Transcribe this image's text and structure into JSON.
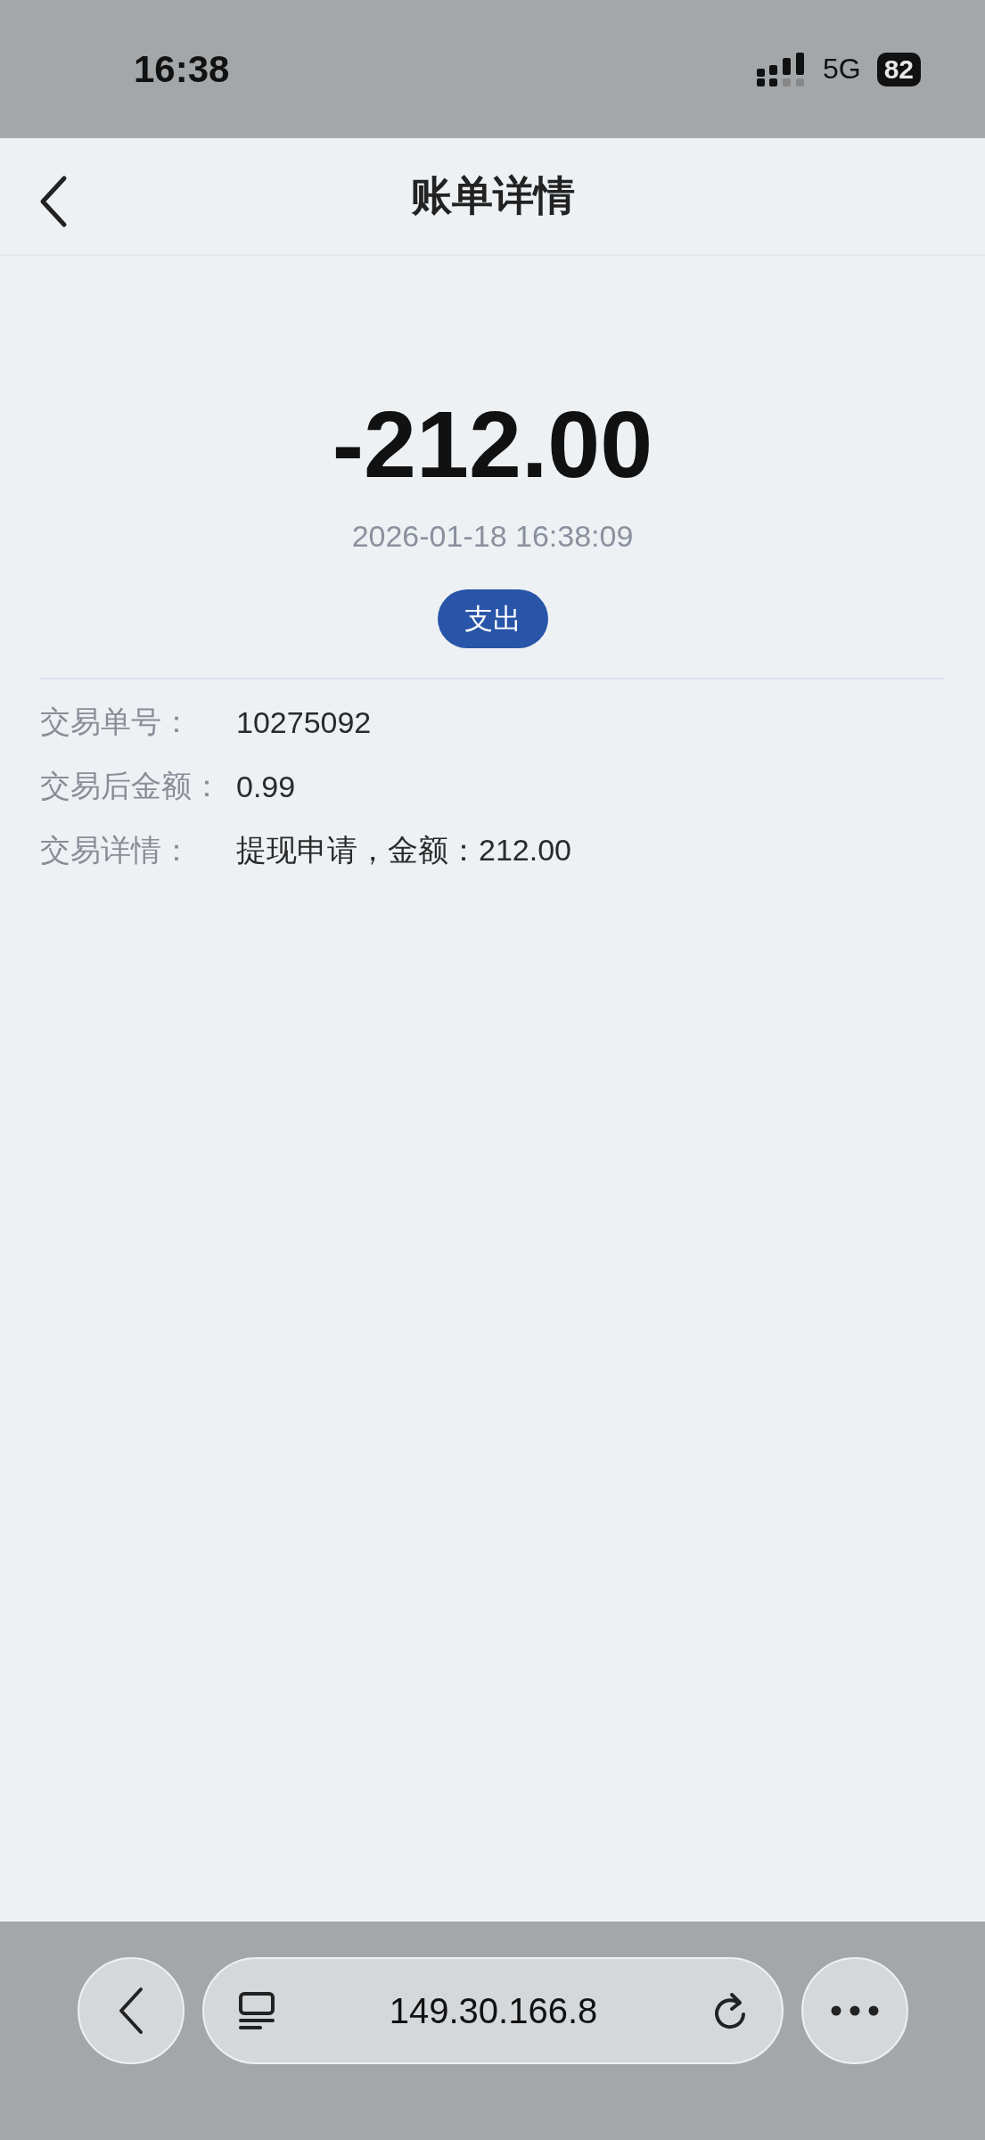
{
  "status_bar": {
    "time": "16:38",
    "network": "5G",
    "battery": "82"
  },
  "header": {
    "title": "账单详情"
  },
  "bill": {
    "amount": "-212.00",
    "datetime": "2026-01-18 16:38:09",
    "badge": "支出"
  },
  "details": [
    {
      "label": "交易单号：",
      "value": "10275092"
    },
    {
      "label": "交易后金额：",
      "value": "0.99"
    },
    {
      "label": "交易详情：",
      "value": "提现申请，金额：212.00"
    }
  ],
  "browser": {
    "url": "149.30.166.8"
  }
}
